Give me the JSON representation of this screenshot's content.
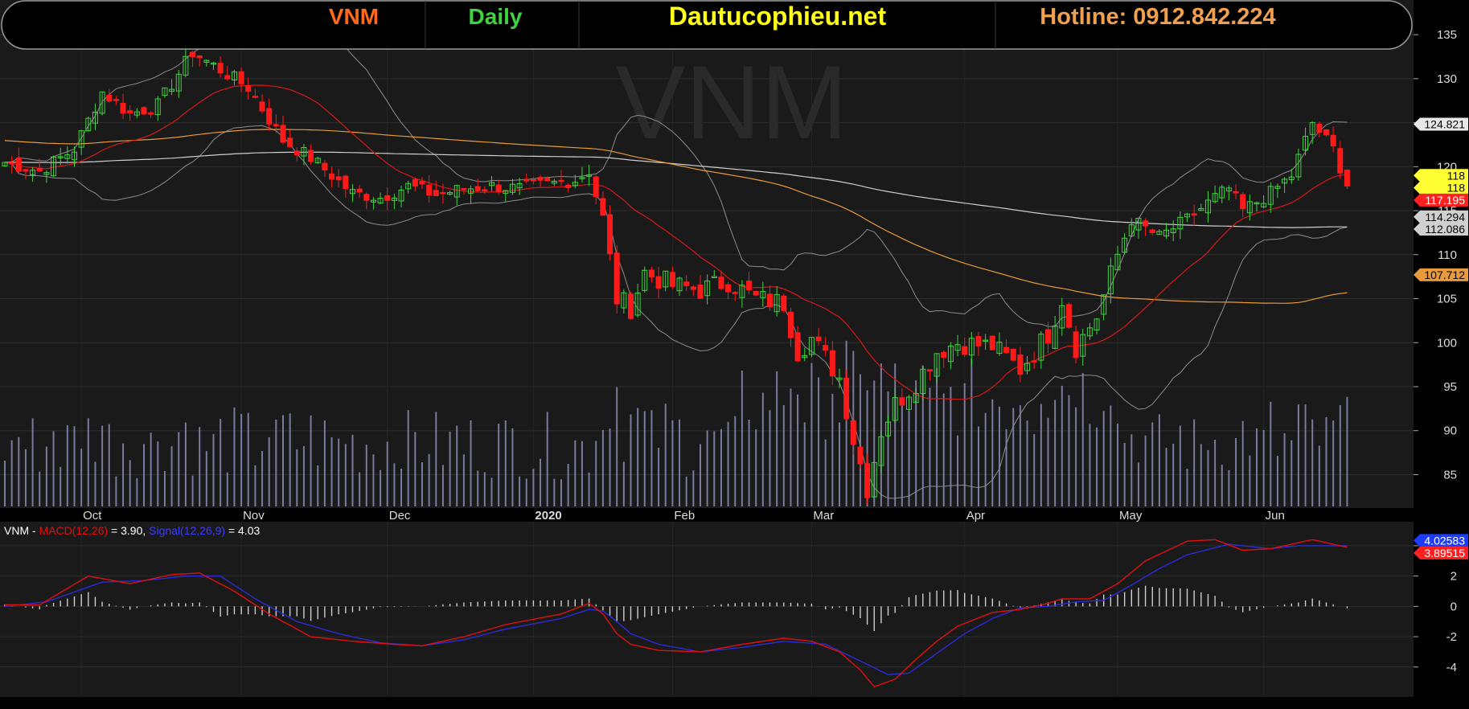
{
  "header": {
    "symbol": "VNM",
    "timeframe": "Daily",
    "site": "Dautucophieu.net",
    "hotline": "Hotline: 0912.842.224",
    "watermark": "VNM"
  },
  "colors": {
    "background": "#000000",
    "plot_bg": "#1a1a1a",
    "up": "#3fd43f",
    "down": "#ff1a1a",
    "volume": "#7a7a9e",
    "bollinger": "#8c8c8c",
    "sma20": "#d81818",
    "sma_orange": "#e89a3c",
    "sma_white": "#cfcfcf",
    "macd": "#e01010",
    "signal": "#2b2bd8",
    "histogram": "#cfcfcf"
  },
  "x_axis": {
    "labels": [
      "Oct",
      "Nov",
      "Dec",
      "2020",
      "Feb",
      "Mar",
      "Apr",
      "May",
      "Jun"
    ],
    "label_index": [
      11,
      34,
      55,
      76,
      96,
      116,
      138,
      160,
      181
    ]
  },
  "price_axis": {
    "ticks": [
      "135",
      "130",
      "125",
      "120",
      "115",
      "110",
      "105",
      "100",
      "95",
      "90",
      "85"
    ],
    "ylim": [
      82.3,
      136.2
    ]
  },
  "price_labels": [
    {
      "text": "124.821",
      "value": 124.821,
      "bg": "#e8e8e8",
      "fg": "#000000"
    },
    {
      "text": "118",
      "value": 119.0,
      "bg": "#ffff33",
      "fg": "#000000"
    },
    {
      "text": "118",
      "value": 117.6,
      "bg": "#ffff33",
      "fg": "#000000"
    },
    {
      "text": "117.195",
      "value": 116.2,
      "bg": "#ff2020",
      "fg": "#ffffff"
    },
    {
      "text": "114.294",
      "value": 114.294,
      "bg": "#d0d0d0",
      "fg": "#000000"
    },
    {
      "text": "112.086",
      "value": 112.9,
      "bg": "#d0d0d0",
      "fg": "#000000"
    },
    {
      "text": "107.712",
      "value": 107.712,
      "bg": "#e89a3c",
      "fg": "#000000"
    }
  ],
  "macd_panel": {
    "legend_symbol": "VNM - ",
    "legend_macd": "MACD(12,26)",
    "legend_macd_value": " = 3.90, ",
    "legend_signal": "Signal(12,26,9)",
    "legend_signal_value": " = 4.03",
    "ticks": [
      "4",
      "2",
      "0",
      "-2",
      "-4"
    ],
    "ylim": [
      -5.6,
      5.0
    ],
    "labels": [
      {
        "text": "4.02583",
        "value": 4.026,
        "bg": "#1c3cff",
        "fg": "#ffffff"
      },
      {
        "text": "3.89515",
        "value": 3.895,
        "bg": "#ff2020",
        "fg": "#ffffff"
      }
    ]
  },
  "chart_data": {
    "type": "candlestick",
    "title": "VNM Daily",
    "ylim": [
      82.3,
      136.2
    ],
    "close_anchors": [
      [
        0,
        120.5
      ],
      [
        5,
        119.5
      ],
      [
        10,
        122
      ],
      [
        14,
        128.5
      ],
      [
        18,
        126
      ],
      [
        22,
        127
      ],
      [
        27,
        133
      ],
      [
        31,
        131
      ],
      [
        35,
        129
      ],
      [
        40,
        123
      ],
      [
        44,
        121
      ],
      [
        50,
        117
      ],
      [
        54,
        116.5
      ],
      [
        58,
        117.8
      ],
      [
        62,
        116.8
      ],
      [
        66,
        117.5
      ],
      [
        70,
        117.8
      ],
      [
        74,
        117.5
      ],
      [
        78,
        118
      ],
      [
        82,
        118.5
      ],
      [
        84,
        119.5
      ],
      [
        86,
        114
      ],
      [
        88,
        105
      ],
      [
        90,
        104
      ],
      [
        92,
        108
      ],
      [
        96,
        106.5
      ],
      [
        100,
        106
      ],
      [
        104,
        107
      ],
      [
        108,
        105
      ],
      [
        112,
        104.5
      ],
      [
        114,
        99
      ],
      [
        116,
        100.5
      ],
      [
        120,
        96
      ],
      [
        122,
        89
      ],
      [
        124,
        83.5
      ],
      [
        126,
        90
      ],
      [
        128,
        93
      ],
      [
        131,
        95.5
      ],
      [
        134,
        99
      ],
      [
        137,
        100
      ],
      [
        142,
        99.6
      ],
      [
        146,
        97
      ],
      [
        150,
        101
      ],
      [
        152,
        105
      ],
      [
        154,
        99.5
      ],
      [
        157,
        103
      ],
      [
        160,
        110
      ],
      [
        162,
        114
      ],
      [
        164,
        113
      ],
      [
        166,
        112
      ],
      [
        170,
        114
      ],
      [
        174,
        116.5
      ],
      [
        176,
        117.5
      ],
      [
        178,
        115
      ],
      [
        182,
        117
      ],
      [
        185,
        119
      ],
      [
        188,
        125
      ],
      [
        191,
        122
      ],
      [
        193,
        118
      ]
    ],
    "volume_ylim": [
      0,
      6.2
    ]
  },
  "macd_data": {
    "macd_anchors": [
      [
        0,
        0.1
      ],
      [
        5,
        0.1
      ],
      [
        12,
        2.0
      ],
      [
        18,
        1.5
      ],
      [
        24,
        2.1
      ],
      [
        28,
        2.2
      ],
      [
        33,
        1.0
      ],
      [
        38,
        -0.5
      ],
      [
        44,
        -2.0
      ],
      [
        50,
        -2.3
      ],
      [
        56,
        -2.5
      ],
      [
        60,
        -2.6
      ],
      [
        66,
        -2.0
      ],
      [
        72,
        -1.2
      ],
      [
        80,
        -0.5
      ],
      [
        84,
        0.2
      ],
      [
        86,
        -0.5
      ],
      [
        88,
        -1.8
      ],
      [
        90,
        -2.5
      ],
      [
        94,
        -2.9
      ],
      [
        100,
        -3.0
      ],
      [
        106,
        -2.5
      ],
      [
        112,
        -2.1
      ],
      [
        116,
        -2.3
      ],
      [
        120,
        -3.0
      ],
      [
        123,
        -4.2
      ],
      [
        125,
        -5.3
      ],
      [
        128,
        -4.8
      ],
      [
        131,
        -3.5
      ],
      [
        134,
        -2.3
      ],
      [
        137,
        -1.3
      ],
      [
        142,
        -0.4
      ],
      [
        146,
        -0.2
      ],
      [
        150,
        0.2
      ],
      [
        152,
        0.5
      ],
      [
        156,
        0.5
      ],
      [
        160,
        1.5
      ],
      [
        164,
        3.0
      ],
      [
        170,
        4.3
      ],
      [
        174,
        4.4
      ],
      [
        178,
        3.7
      ],
      [
        182,
        3.8
      ],
      [
        186,
        4.2
      ],
      [
        188,
        4.4
      ],
      [
        193,
        3.9
      ]
    ],
    "signal_anchors": [
      [
        0,
        0.0
      ],
      [
        6,
        0.3
      ],
      [
        14,
        1.6
      ],
      [
        20,
        1.7
      ],
      [
        26,
        2.0
      ],
      [
        31,
        2.0
      ],
      [
        36,
        0.5
      ],
      [
        42,
        -1.0
      ],
      [
        48,
        -1.8
      ],
      [
        54,
        -2.4
      ],
      [
        60,
        -2.6
      ],
      [
        66,
        -2.2
      ],
      [
        72,
        -1.5
      ],
      [
        80,
        -0.8
      ],
      [
        84,
        -0.2
      ],
      [
        86,
        -0.3
      ],
      [
        88,
        -1.0
      ],
      [
        90,
        -1.8
      ],
      [
        94,
        -2.5
      ],
      [
        100,
        -3.0
      ],
      [
        106,
        -2.7
      ],
      [
        112,
        -2.3
      ],
      [
        118,
        -2.5
      ],
      [
        123,
        -3.6
      ],
      [
        127,
        -4.5
      ],
      [
        130,
        -4.4
      ],
      [
        134,
        -3.1
      ],
      [
        138,
        -1.8
      ],
      [
        142,
        -0.8
      ],
      [
        146,
        -0.1
      ],
      [
        150,
        0.0
      ],
      [
        154,
        0.3
      ],
      [
        158,
        0.4
      ],
      [
        162,
        1.4
      ],
      [
        166,
        2.5
      ],
      [
        170,
        3.4
      ],
      [
        176,
        4.1
      ],
      [
        182,
        3.8
      ],
      [
        186,
        4.0
      ],
      [
        193,
        4.0
      ]
    ]
  }
}
